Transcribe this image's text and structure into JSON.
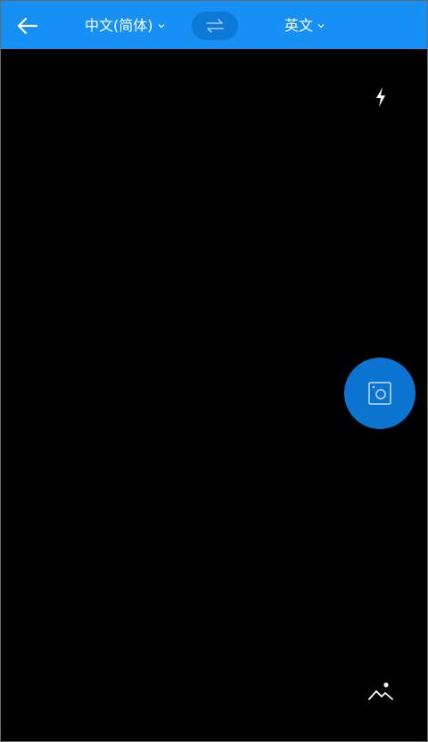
{
  "header": {
    "source_language": "中文(简体)",
    "target_language": "英文",
    "back_icon": "arrow-left-icon",
    "swap_icon": "swap-arrows-icon",
    "chevron_icon": "chevron-down-icon"
  },
  "camera": {
    "flash_icon": "flash-icon",
    "shutter_icon": "camera-icon",
    "gallery_icon": "image-gallery-icon"
  },
  "colors": {
    "header_bg": "#1690f5",
    "swap_bg": "#0c79d6",
    "shutter_bg": "#0a74d0",
    "viewfinder_bg": "#000000",
    "text": "#ffffff"
  }
}
